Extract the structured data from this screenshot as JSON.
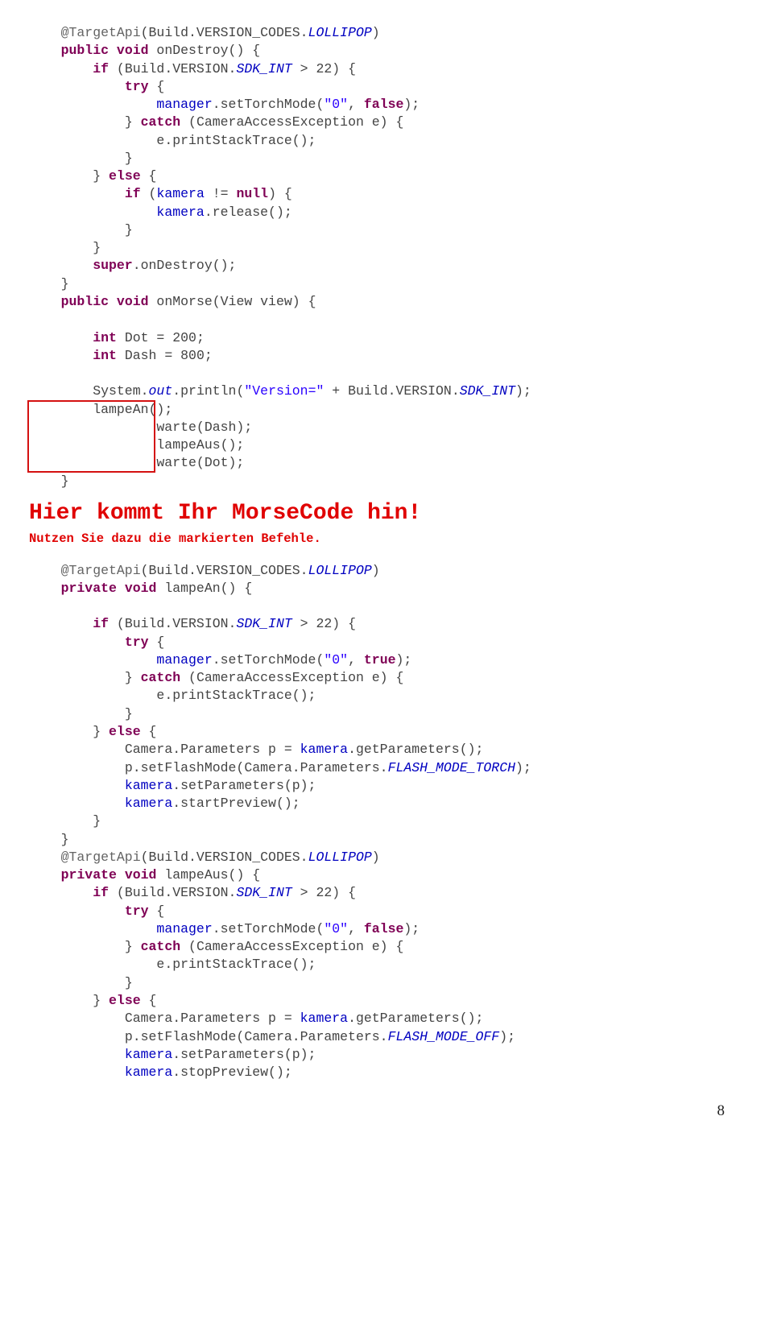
{
  "lines": {
    "l1a": "@TargetApi",
    "l1b": "(Build.VERSION_CODES.",
    "l1c": "LOLLIPOP",
    "l1d": ")",
    "l2a": "public",
    "l2b": " ",
    "l2c": "void",
    "l2d": " onDestroy() {",
    "l3a": "if",
    "l3b": " (Build.VERSION.",
    "l3c": "SDK_INT",
    "l3d": " > 22) {",
    "l4": "try",
    "l4b": " {",
    "l5a": "manager",
    "l5b": ".setTorchMode(",
    "l5c": "\"0\"",
    "l5d": ", ",
    "l5e": "false",
    "l5f": ");",
    "l6a": "} ",
    "l6b": "catch",
    "l6c": " (CameraAccessException e) {",
    "l7": "e.printStackTrace();",
    "l8": "}",
    "l9a": "} ",
    "l9b": "else",
    "l9c": " {",
    "l10a": "if",
    "l10b": " (",
    "l10c": "kamera",
    "l10d": " != ",
    "l10e": "null",
    "l10f": ") {",
    "l11a": "kamera",
    "l11b": ".release();",
    "l12": "}",
    "l13": "}",
    "l14a": "super",
    "l14b": ".onDestroy();",
    "l15": "}",
    "m1a": "public",
    "m1b": " ",
    "m1c": "void",
    "m1d": " onMorse(View view) {",
    "m2a": "int",
    "m2b": " Dot = 200;",
    "m3a": "int",
    "m3b": " Dash = 800;",
    "m4a": "System.",
    "m4b": "out",
    "m4c": ".println(",
    "m4d": "\"Version=\"",
    "m4e": " + Build.VERSION.",
    "m4f": "SDK_INT",
    "m4g": ");",
    "m5": "lampeAn();",
    "m6": "warte(Dash);",
    "m7": "lampeAus();",
    "m8": "warte(Dot);",
    "m9": "}",
    "heading": "Hier kommt Ihr MorseCode hin!",
    "sub": "Nutzen Sie dazu die markierten Befehle.",
    "a1a": "@TargetApi",
    "a1b": "(Build.VERSION_CODES.",
    "a1c": "LOLLIPOP",
    "a1d": ")",
    "a2a": "private",
    "a2b": " ",
    "a2c": "void",
    "a2d": " lampeAn() {",
    "a3a": "if",
    "a3b": " (Build.VERSION.",
    "a3c": "SDK_INT",
    "a3d": " > 22) {",
    "a4a": "try",
    "a4b": " {",
    "a5a": "manager",
    "a5b": ".setTorchMode(",
    "a5c": "\"0\"",
    "a5d": ", ",
    "a5e": "true",
    "a5f": ");",
    "a6a": "} ",
    "a6b": "catch",
    "a6c": " (CameraAccessException e) {",
    "a7": "e.printStackTrace();",
    "a8": "}",
    "a9a": "} ",
    "a9b": "else",
    "a9c": " {",
    "a10a": "Camera.Parameters p = ",
    "a10b": "kamera",
    "a10c": ".getParameters();",
    "a11a": "p.setFlashMode(Camera.Parameters.",
    "a11b": "FLASH_MODE_TORCH",
    "a11c": ");",
    "a12a": "kamera",
    "a12b": ".setParameters(p);",
    "a13a": "kamera",
    "a13b": ".startPreview();",
    "a14": "}",
    "a15": "}",
    "b1a": "@TargetApi",
    "b1b": "(Build.VERSION_CODES.",
    "b1c": "LOLLIPOP",
    "b1d": ")",
    "b2a": "private",
    "b2b": " ",
    "b2c": "void",
    "b2d": " lampeAus() {",
    "b3a": "if",
    "b3b": " (Build.VERSION.",
    "b3c": "SDK_INT",
    "b3d": " > 22) {",
    "b4a": "try",
    "b4b": " {",
    "b5a": "manager",
    "b5b": ".setTorchMode(",
    "b5c": "\"0\"",
    "b5d": ", ",
    "b5e": "false",
    "b5f": ");",
    "b6a": "} ",
    "b6b": "catch",
    "b6c": " (CameraAccessException e) {",
    "b7": "e.printStackTrace();",
    "b8": "}",
    "b9a": "} ",
    "b9b": "else",
    "b9c": " {",
    "b10a": "Camera.Parameters p = ",
    "b10b": "kamera",
    "b10c": ".getParameters();",
    "b11a": "p.setFlashMode(Camera.Parameters.",
    "b11b": "FLASH_MODE_OFF",
    "b11c": ");",
    "b12a": "kamera",
    "b12b": ".setParameters(p);",
    "b13a": "kamera",
    "b13b": ".stopPreview();"
  },
  "page": "8"
}
